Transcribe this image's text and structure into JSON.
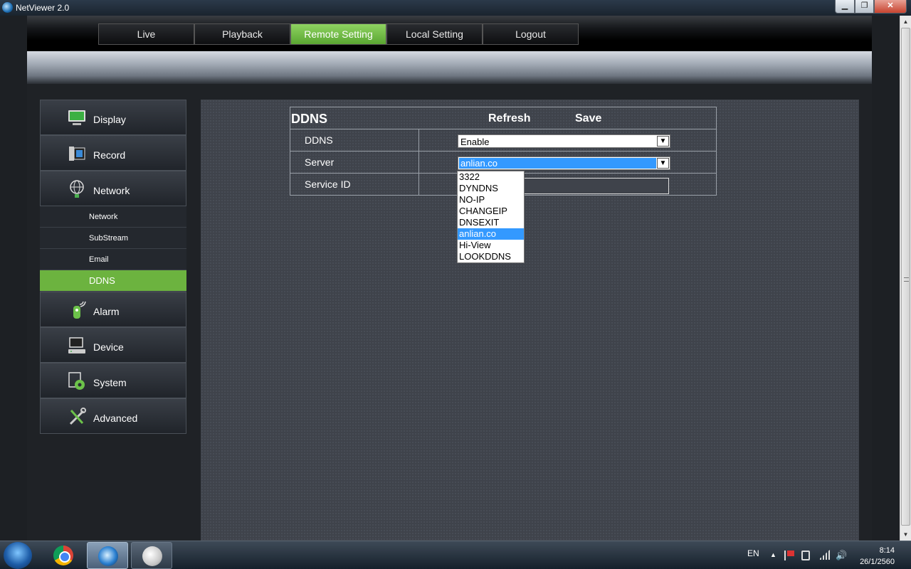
{
  "window": {
    "title": "NetViewer 2.0",
    "minimize_label": "▁",
    "maximize_label": "❐",
    "close_label": "✕"
  },
  "topnav": {
    "tabs": [
      {
        "label": "Live"
      },
      {
        "label": "Playback"
      },
      {
        "label": "Remote Setting",
        "active": true
      },
      {
        "label": "Local Setting"
      },
      {
        "label": "Logout"
      }
    ]
  },
  "sidebar": {
    "items": [
      {
        "label": "Display",
        "icon": "monitor-icon"
      },
      {
        "label": "Record",
        "icon": "film-icon"
      },
      {
        "label": "Network",
        "icon": "globe-icon"
      }
    ],
    "network_sub": [
      {
        "label": "Network"
      },
      {
        "label": "SubStream"
      },
      {
        "label": "Email"
      },
      {
        "label": "DDNS",
        "active": true
      }
    ],
    "items_after": [
      {
        "label": "Alarm",
        "icon": "alarm-icon"
      },
      {
        "label": "Device",
        "icon": "device-icon"
      },
      {
        "label": "System",
        "icon": "system-gear-icon"
      },
      {
        "label": "Advanced",
        "icon": "wrench-icon"
      }
    ]
  },
  "ddns_panel": {
    "title": "DDNS",
    "refresh_label": "Refresh",
    "save_label": "Save",
    "rows": {
      "ddns": {
        "label": "DDNS",
        "value": "Enable"
      },
      "server": {
        "label": "Server",
        "value": "anlian.co"
      },
      "service_id": {
        "label": "Service ID",
        "value": ""
      }
    },
    "server_options": [
      "3322",
      "DYNDNS",
      "NO-IP",
      "CHANGEIP",
      "DNSEXIT",
      "anlian.co",
      "Hi-View",
      "LOOKDDNS"
    ],
    "selected_option": "anlian.co"
  },
  "taskbar": {
    "apps": [
      "chrome-icon",
      "netviewer-icon",
      "paint-icon"
    ],
    "lang": "EN",
    "time": "8:14",
    "date": "26/1/2560"
  },
  "colors": {
    "accent": "#6cb33f",
    "selection": "#3399ff"
  }
}
